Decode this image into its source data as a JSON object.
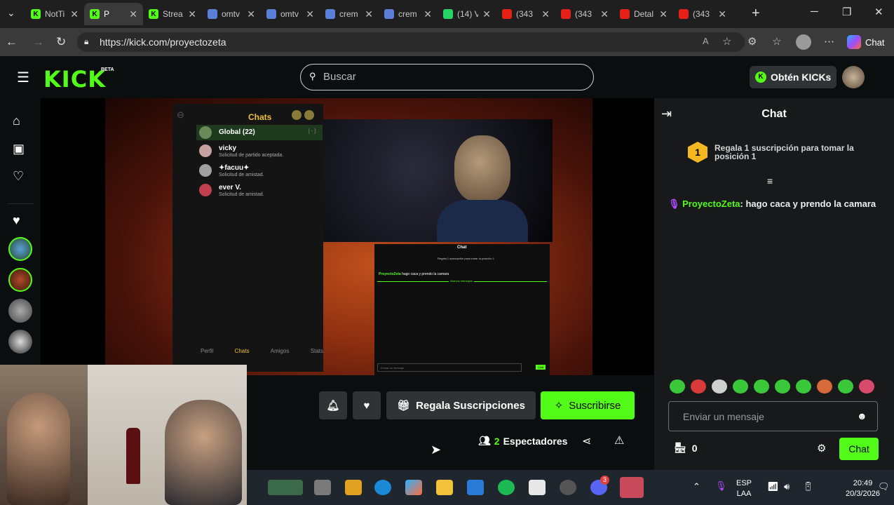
{
  "browser": {
    "tabs": [
      {
        "label": "NotTi",
        "favicon": "kick",
        "color": "#53fc18"
      },
      {
        "label": "P",
        "favicon": "kick",
        "color": "#53fc18",
        "active": true
      },
      {
        "label": "Strea",
        "favicon": "kick",
        "color": "#53fc18"
      },
      {
        "label": "omtv",
        "favicon": "search",
        "color": "#5b7fd6"
      },
      {
        "label": "omtv",
        "favicon": "search",
        "color": "#5b7fd6"
      },
      {
        "label": "crem",
        "favicon": "search",
        "color": "#5b7fd6"
      },
      {
        "label": "crem",
        "favicon": "search",
        "color": "#5b7fd6"
      },
      {
        "label": "(14) V",
        "favicon": "whatsapp",
        "color": "#25d366"
      },
      {
        "label": "(343",
        "favicon": "youtube",
        "color": "#e62117"
      },
      {
        "label": "(343",
        "favicon": "youtube",
        "color": "#e62117"
      },
      {
        "label": "Detal",
        "favicon": "youtube",
        "color": "#e62117"
      },
      {
        "label": "(343",
        "favicon": "youtube",
        "color": "#e62117"
      }
    ],
    "url": "https://kick.com/proyectozeta",
    "copilot_label": "Chat"
  },
  "kick": {
    "logo": "KICK",
    "logo_badge": "BETA",
    "search_placeholder": "Buscar",
    "get_kicks": "Obtén KICKs",
    "brand_color": "#53fc18"
  },
  "stream": {
    "phone": {
      "title": "Chats",
      "global": "Global (22)",
      "global_suffix": "[ - ]",
      "contacts": [
        {
          "name": "vicky",
          "sub": "Solicitud de partido aceptada."
        },
        {
          "name": "✦facuu✦",
          "sub": "Solicitud de amistad."
        },
        {
          "name": "ever V.",
          "sub": "Solicitud de amistad."
        }
      ],
      "nav": [
        "Perfil",
        "Chats",
        "Amigos",
        "Stats"
      ]
    },
    "mini_chat": {
      "title": "Chat",
      "pinned": "Regala 1 suscripción para tomar la posición 1",
      "message_user": "ProyectoZeta",
      "message_text": "hago caca y prendo la camara",
      "new_messages": "Nuevos mensajes",
      "input_placeholder": "Enviar un mensaje",
      "send": "Chat"
    }
  },
  "controls": {
    "gift_subs": "Regala Suscripciones",
    "subscribe": "Suscribirse",
    "viewers_count": "2",
    "viewers_label": "Espectadores"
  },
  "chat": {
    "title": "Chat",
    "pinned_rank": "1",
    "pinned_text": "Regala 1 suscripción para tomar la posición 1",
    "messages": [
      {
        "user": "ProyectoZeta",
        "text": "hago caca y prendo la camara",
        "user_color": "#53fc18"
      }
    ],
    "input_placeholder": "Enviar un mensaje",
    "points": "0",
    "send_label": "Chat"
  },
  "taskbar": {
    "language": "ESP",
    "layout": "LAA",
    "time": "20:49",
    "date": "20/3/2026",
    "discord_badge": "3"
  }
}
